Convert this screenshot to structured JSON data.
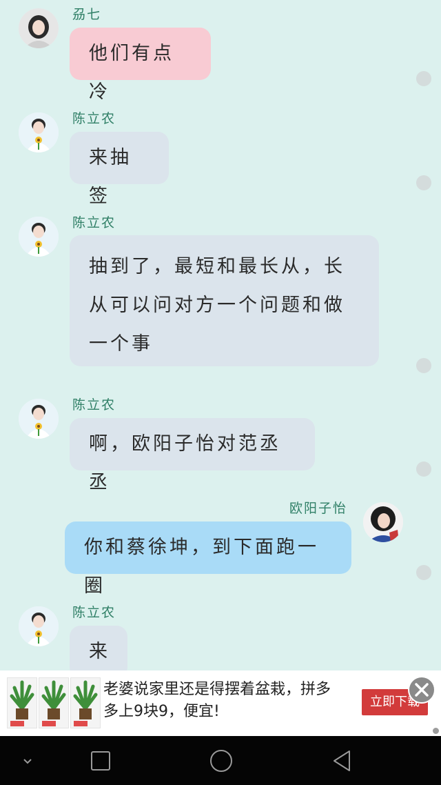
{
  "messages": [
    {
      "sender": "刕七",
      "text": "他们有点冷",
      "side": "left",
      "color": "pink"
    },
    {
      "sender": "陈立农",
      "text": "来抽签",
      "side": "left",
      "color": "gray"
    },
    {
      "sender": "陈立农",
      "text": "抽到了，最短和最长从，长从可以问对方一个问题和做一个事",
      "side": "left",
      "color": "gray"
    },
    {
      "sender": "陈立农",
      "text": "啊，欧阳子怡对范丞丞",
      "side": "left",
      "color": "gray"
    },
    {
      "sender": "欧阳子怡",
      "text": "你和蔡徐坤，到下面跑一圈",
      "side": "right",
      "color": "blue"
    },
    {
      "sender": "陈立农",
      "text": "来",
      "side": "left",
      "color": "gray"
    }
  ],
  "ad": {
    "text": "老婆说家里还是得摆着盆栽，拼多多上9块9，便宜!",
    "button": "立即下载",
    "thumb_price": "¥9.9"
  },
  "colors": {
    "background": "#dcf1ee",
    "bubble_pink": "#f8cbd3",
    "bubble_gray": "#dbe4ec",
    "bubble_blue": "#a9dbf7",
    "name": "#2f7f66",
    "ad_button": "#d23b3b"
  },
  "icons": {
    "ad_close": "close-icon",
    "nav_back": "triangle-back-icon",
    "nav_home": "circle-home-icon",
    "nav_recent": "square-recent-icon",
    "nav_hide": "chevron-down-icon"
  }
}
